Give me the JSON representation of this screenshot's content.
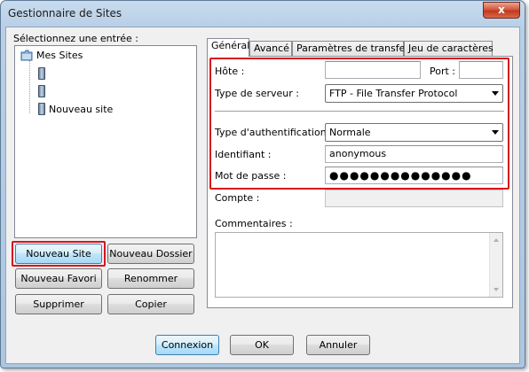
{
  "window": {
    "title": "Gestionnaire de Sites",
    "close_glyph": "x"
  },
  "left": {
    "select_label": "Sélectionnez une entrée :",
    "tree": {
      "root_label": "Mes Sites",
      "new_site_label": "Nouveau site"
    },
    "buttons": {
      "new_site": "Nouveau Site",
      "new_folder": "Nouveau Dossier",
      "new_bookmark": "Nouveau Favori",
      "rename": "Renommer",
      "delete": "Supprimer",
      "copy": "Copier"
    }
  },
  "tabs": [
    "Général",
    "Avancé",
    "Paramètres de transfert",
    "Jeu de caractères"
  ],
  "general": {
    "host_label": "Hôte :",
    "host_value": "",
    "port_label": "Port :",
    "port_value": "",
    "server_type_label": "Type de serveur :",
    "server_type_value": "FTP - File Transfer Protocol",
    "auth_type_label": "Type d'authentification :",
    "auth_type_value": "Normale",
    "user_label": "Identifiant :",
    "user_value": "anonymous",
    "password_label": "Mot de passe :",
    "password_value": "●●●●●●●●●●●●●●",
    "account_label": "Compte :",
    "account_value": "",
    "comments_label": "Commentaires :",
    "comments_value": ""
  },
  "footer": {
    "connect": "Connexion",
    "ok": "OK",
    "cancel": "Annuler"
  },
  "colors": {
    "highlight": "#d6141d",
    "default_button_border": "#3c7fb1"
  },
  "icons": {
    "root": "folder-icon",
    "server": "server-icon"
  }
}
